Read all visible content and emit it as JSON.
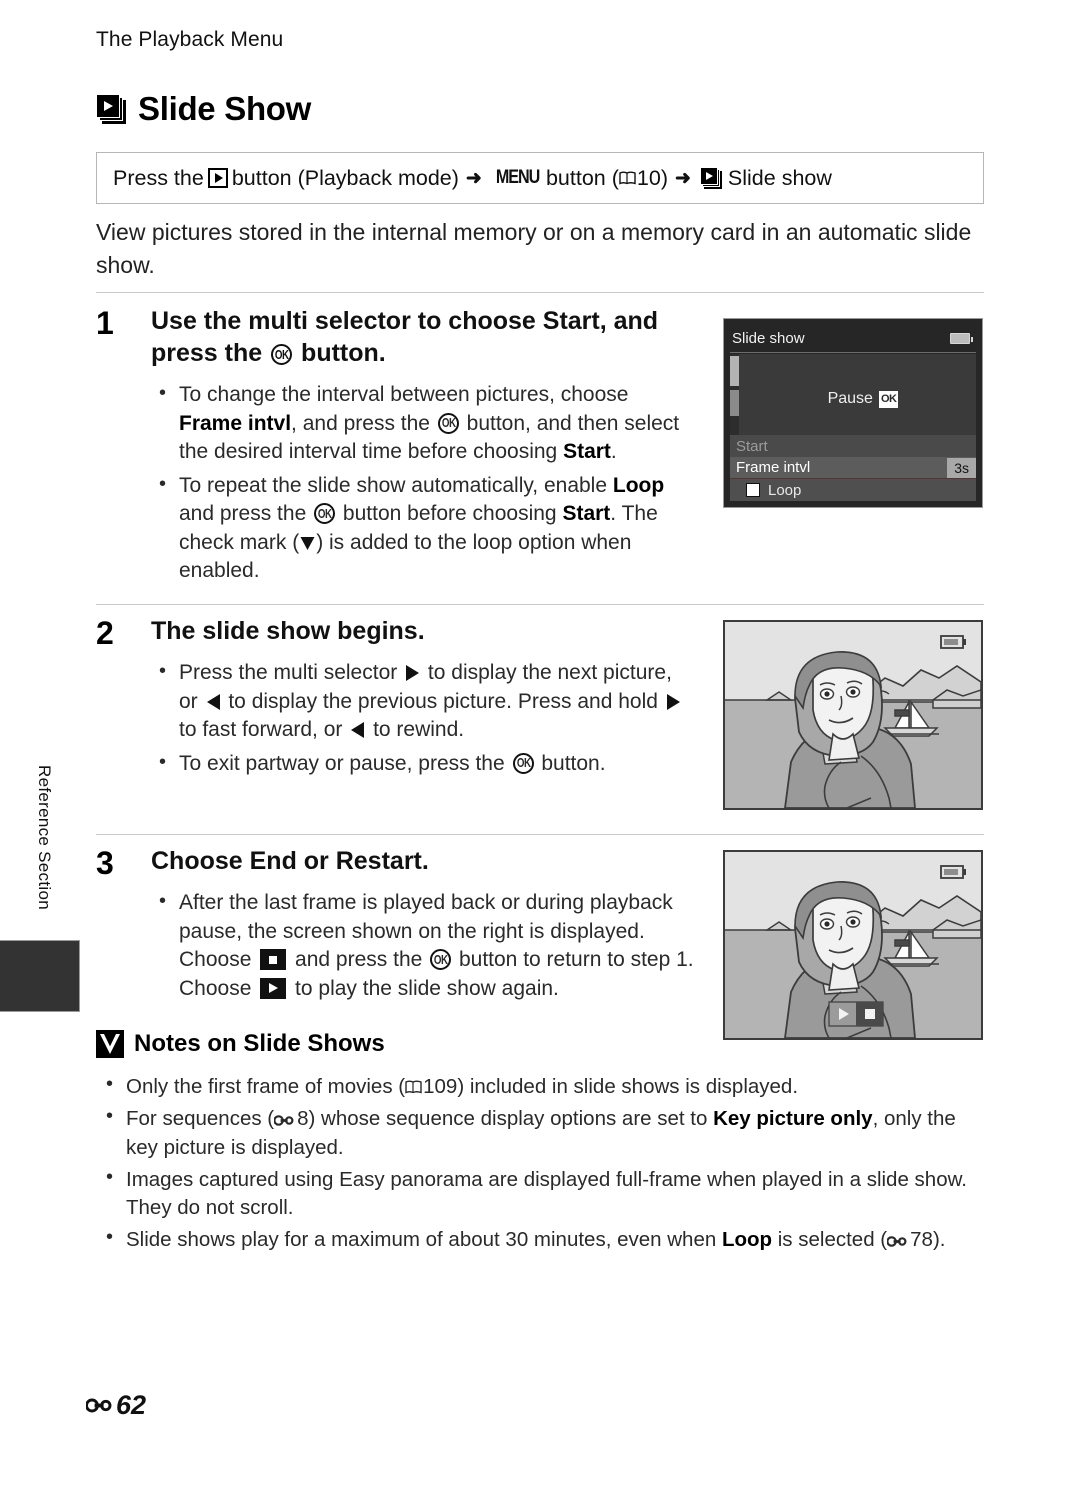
{
  "running_header": "The Playback Menu",
  "chapter": {
    "icon": "slideshow-stack-icon",
    "title": "Slide Show"
  },
  "path_box": {
    "seg1": "Press the",
    "playback_icon": "playback-button-icon",
    "seg2": "button (Playback mode)",
    "arrow1": "➜",
    "menu_label": "MENU",
    "seg3": "button (",
    "book_icon": "manual-book-icon",
    "page_ref": "10",
    "seg4": ")",
    "arrow2": "➜",
    "slideshow_icon": "slideshow-stack-icon",
    "seg5": "Slide show"
  },
  "intro": "View pictures stored in the internal memory or on a memory card in an automatic slide show.",
  "steps": [
    {
      "num": "1",
      "head_a": "Use the multi selector to choose ",
      "head_b": "Start",
      "head_c": ", and press the ",
      "head_ok": "OK",
      "head_d": " button.",
      "bullets": [
        {
          "a": "To change the interval between pictures, choose ",
          "b": "Frame intvl",
          "c": ", and press the ",
          "d": " button, and then select the desired interval time before choosing ",
          "e": "Start",
          "f": "."
        },
        {
          "a": "To repeat the slide show automatically, enable ",
          "b": "Loop",
          "c": " and press the ",
          "d": " button before choosing ",
          "e": "Start",
          "f": ". The check mark (",
          "g": ") is added to the loop option when enabled."
        }
      ]
    },
    {
      "num": "2",
      "head_a": "The slide show begins.",
      "bullets": [
        {
          "a": "Press the multi selector ",
          "b": " to display the next picture, or ",
          "c": " to display the previous picture. Press and hold ",
          "d": " to fast forward, or ",
          "e": " to rewind."
        },
        {
          "a": "To exit partway or pause, press the ",
          "b": " button."
        }
      ]
    },
    {
      "num": "3",
      "head_a": "Choose End or Restart.",
      "bullets": [
        {
          "a": "After the last frame is played back or during playback pause, the screen shown on the right is displayed. Choose ",
          "b": " and press the ",
          "c": " button to return to step 1. Choose ",
          "d": " to play the slide show again."
        }
      ]
    }
  ],
  "lcd": {
    "title": "Slide show",
    "battery_icon": "battery-full-icon",
    "pause_label": "Pause",
    "pause_button": "OK",
    "rows": [
      {
        "label": "Start",
        "value": "",
        "state": "dimmed"
      },
      {
        "label": "Frame intvl",
        "value": "3s",
        "state": "selected"
      },
      {
        "label": "Loop",
        "value": "",
        "state": "checkbox-unchecked"
      }
    ]
  },
  "photos": {
    "step2_alt": "slide-show-picture-woman-sailboat",
    "step3_alt": "slide-show-end-screen-with-playback-controls",
    "controls": {
      "play_icon": "play-icon",
      "stop_icon": "stop-end-icon"
    }
  },
  "notes": {
    "icon": "caution-icon",
    "title": "Notes on Slide Shows",
    "items": [
      {
        "a": "Only the first frame of movies (",
        "ref_icon": "manual-book-icon",
        "ref": "109",
        "b": ") included in slide shows is displayed."
      },
      {
        "a": "For sequences (",
        "ref_icon": "reference-section-icon",
        "ref": "8",
        "b": ") whose sequence display options are set to ",
        "bold": "Key picture only",
        "c": ", only the key picture is displayed."
      },
      {
        "a": "Images captured using Easy panorama are displayed full-frame when played in a slide show. They do not scroll."
      },
      {
        "a": "Slide shows play for a maximum of about 30 minutes, even when ",
        "bold": "Loop",
        "b": " is selected (",
        "ref_icon": "reference-section-icon",
        "ref": "78",
        "c": ")."
      }
    ]
  },
  "side_tab_label": "Reference Section",
  "footer": {
    "section_icon": "reference-section-icon",
    "page_number": "62"
  }
}
